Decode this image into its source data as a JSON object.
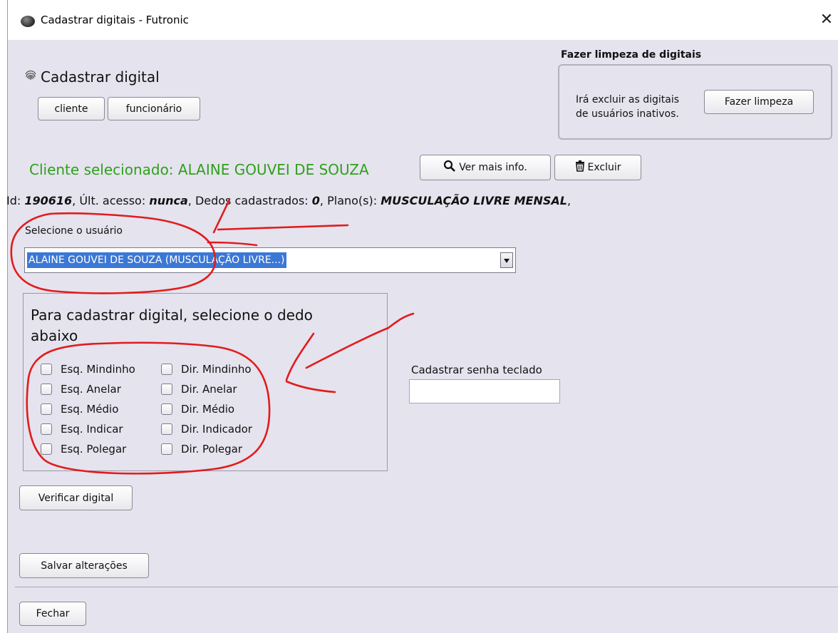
{
  "window": {
    "title": "Cadastrar digitais - Futronic",
    "close_glyph": "✕"
  },
  "register": {
    "heading": "Cadastrar digital",
    "client_button": "cliente",
    "employee_button": "funcionário"
  },
  "cleanup": {
    "group_title": "Fazer limpeza de digitais",
    "description_line1": "Irá excluir as digitais",
    "description_line2": "de usuários inativos.",
    "button": "Fazer limpeza"
  },
  "selected_client": {
    "text": "Cliente selecionado: ALAINE GOUVEI DE SOUZA",
    "color": "#2fa01c",
    "more_info_button": "Ver mais info.",
    "delete_button": "Excluir"
  },
  "info_line": {
    "id_label": "Id: ",
    "id_value": "190616",
    "access_label": ", Últ. acesso: ",
    "access_value": "nunca",
    "fingers_label": ", Dedos cadastrados: ",
    "fingers_value": "0",
    "plan_label": ", Plano(s): ",
    "plan_value": "MUSCULAÇÃO LIVRE MENSAL",
    "trailing": ","
  },
  "user_select": {
    "label": "Selecione o usuário",
    "selected_value": "ALAINE GOUVEI DE SOUZA  (MUSCULAÇÃO LIVRE...)",
    "highlight_color": "#3b78d6"
  },
  "finger_panel": {
    "title_line1": "Para cadastrar digital, selecione o dedo",
    "title_line2": "abaixo",
    "left": [
      "Esq. Mindinho",
      "Esq. Anelar",
      "Esq. Médio",
      "Esq. Indicar",
      "Esq. Polegar"
    ],
    "right": [
      "Dir. Mindinho",
      "Dir. Anelar",
      "Dir. Médio",
      "Dir. Indicador",
      "Dir. Polegar"
    ]
  },
  "keypad_password": {
    "label": "Cadastrar senha teclado",
    "value": ""
  },
  "actions": {
    "verify": "Verificar digital",
    "save": "Salvar alterações",
    "close": "Fechar"
  },
  "annotation_color": "#e21b1b"
}
